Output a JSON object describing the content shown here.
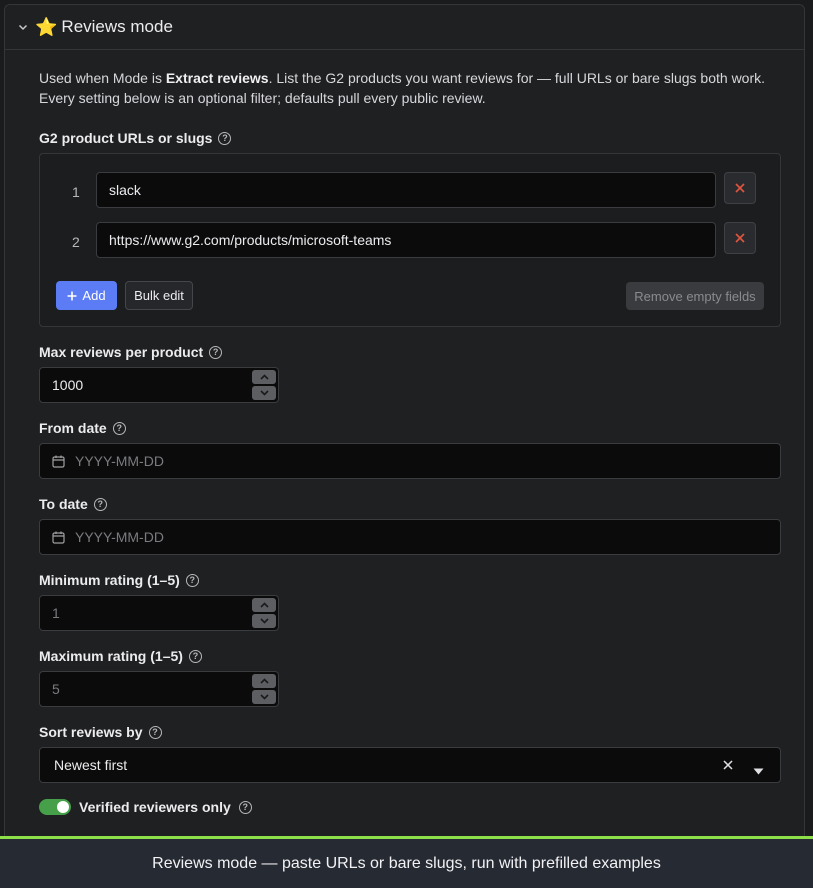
{
  "section": {
    "star": "⭐",
    "title": "Reviews mode"
  },
  "description": {
    "prefix": "Used when Mode is ",
    "mode_name": "Extract reviews",
    "suffix": ". List the G2 products you want reviews for — full URLs or bare slugs both work. Every setting below is an optional filter; defaults pull every public review."
  },
  "products": {
    "label": "G2 product URLs or slugs",
    "items": [
      {
        "index": "1",
        "value": "slack"
      },
      {
        "index": "2",
        "value": "https://www.g2.com/products/microsoft-teams"
      }
    ],
    "add_label": "Add",
    "bulk_edit_label": "Bulk edit",
    "remove_empty_label": "Remove empty fields"
  },
  "max_reviews": {
    "label": "Max reviews per product",
    "value": "1000"
  },
  "from_date": {
    "label": "From date",
    "placeholder": "YYYY-MM-DD"
  },
  "to_date": {
    "label": "To date",
    "placeholder": "YYYY-MM-DD"
  },
  "min_rating": {
    "label": "Minimum rating (1–5)",
    "placeholder": "1"
  },
  "max_rating": {
    "label": "Maximum rating (1–5)",
    "placeholder": "5"
  },
  "sort": {
    "label": "Sort reviews by",
    "value": "Newest first"
  },
  "verified": {
    "label": "Verified reviewers only",
    "enabled": true
  },
  "footer": {
    "caption": "Reviews mode — paste URLs or bare slugs, run with prefilled examples"
  },
  "colors": {
    "accent": "#5b7cf5",
    "toggle_on": "#46a049",
    "danger": "#e0553f",
    "footer_border": "#8ee04a"
  }
}
